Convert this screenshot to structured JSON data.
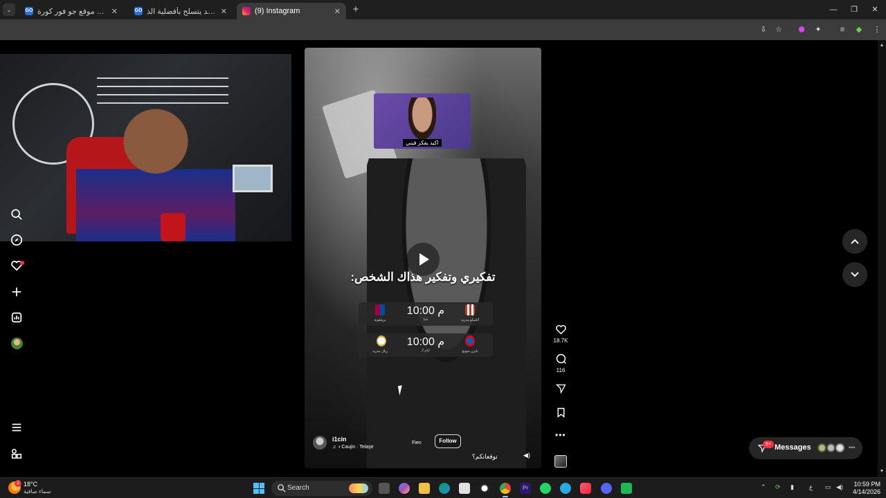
{
  "browser": {
    "tabs": [
      {
        "title": "موقع جو فور كورة – Ar"
      },
      {
        "title": "أتلتيكو مدريد يتسلح بأفضلية الذ"
      },
      {
        "title": "(9) Instagram"
      }
    ],
    "go_favicon": "GO",
    "window_controls": {
      "minimize": "—",
      "maximize": "❐",
      "close": "✕"
    }
  },
  "webcam": {},
  "reel": {
    "meme_caption": "اكيد يفكر فيني",
    "overlay_text": "تفكيري وتفكير هذاك الشخص:",
    "matches": [
      {
        "home": "برشلونة",
        "away": "أتلتيكو مدريد",
        "time": "10:00 م",
        "when": "غدا"
      },
      {
        "home": "ريال مدريد",
        "away": "بايرن ميونخ",
        "time": "10:00 م",
        "when": "2 ايام"
      }
    ],
    "author": "i1cin",
    "music": "♫ ·ı Caujin · Telaşe",
    "fien": "Fien",
    "follow_label": "Follow",
    "caption": "توقعاتكم؟"
  },
  "actions": {
    "likes": "18.7K",
    "comments": "116"
  },
  "messages": {
    "label": "Messages",
    "badge": "9+"
  },
  "taskbar": {
    "weather_temp": "18°C",
    "weather_desc": "سماء صافية",
    "weather_badge": "2",
    "search_placeholder": "Search",
    "tray_lang": "ع",
    "clock_time": "10:59 PM",
    "clock_date": "4/14/2026"
  },
  "colors": {
    "accent_red": "#ff3040",
    "surface": "#262626",
    "background": "#000000"
  }
}
